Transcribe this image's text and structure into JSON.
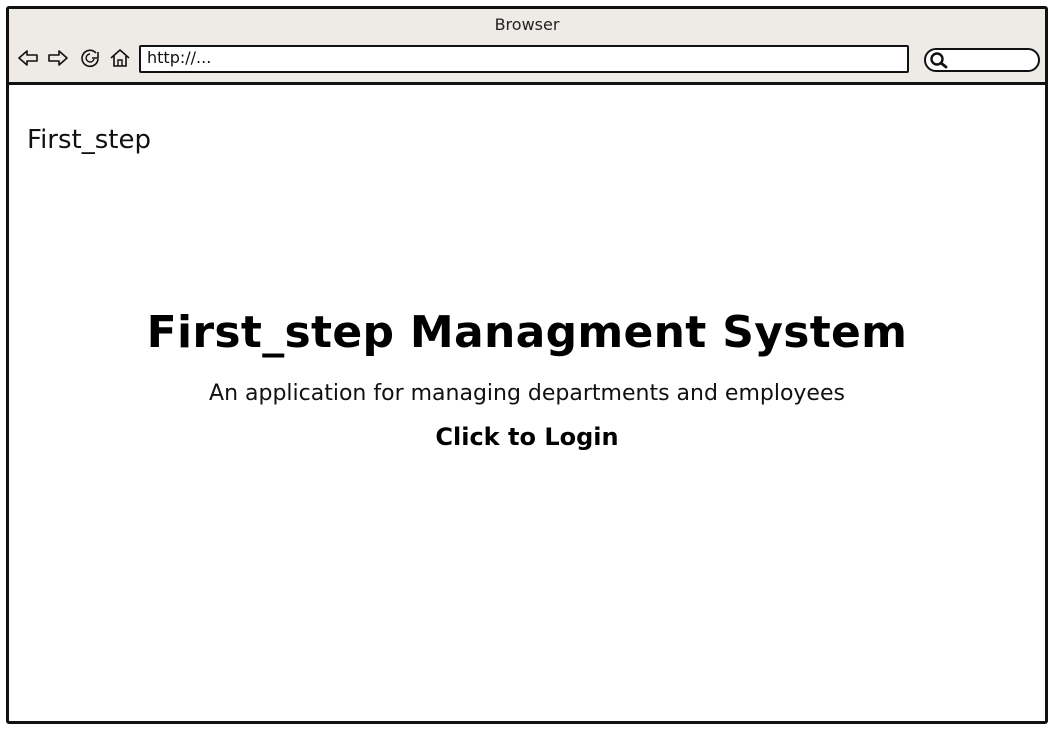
{
  "browser": {
    "window_title": "Browser",
    "url": "http://...",
    "nav_icons": [
      "back-arrow-icon",
      "forward-arrow-icon",
      "reload-icon",
      "home-icon"
    ],
    "search_icon": "search-icon"
  },
  "page": {
    "brand": "First_step",
    "title": "First_step Managment System",
    "subtitle": "An application for managing departments and employees",
    "login_link": "Click to Login"
  }
}
